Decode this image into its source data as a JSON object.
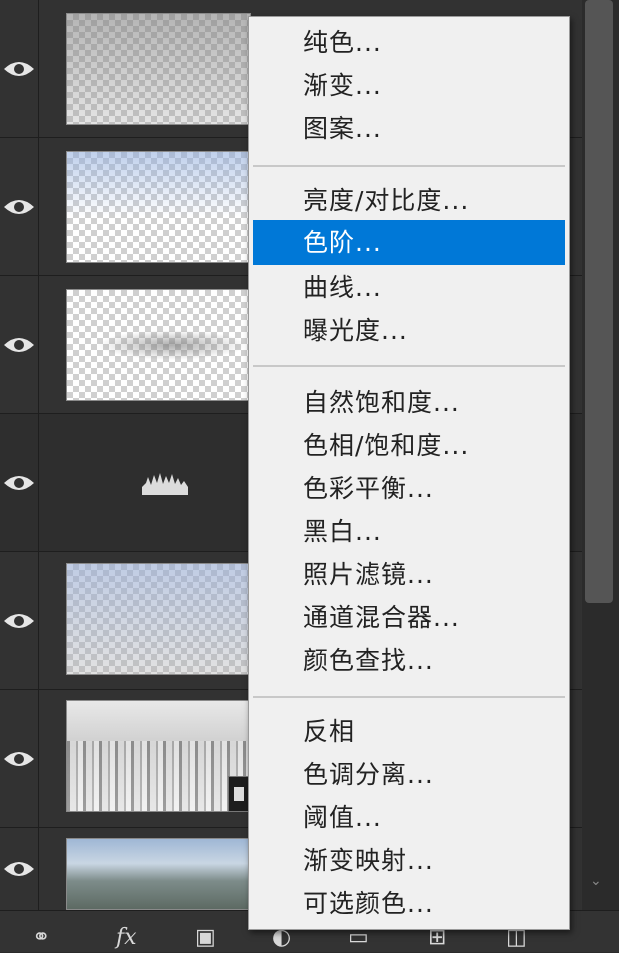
{
  "menu": {
    "groups": [
      [
        "纯色...",
        "渐变...",
        "图案..."
      ],
      [
        "亮度/对比度...",
        "色阶...",
        "曲线...",
        "曝光度..."
      ],
      [
        "自然饱和度...",
        "色相/饱和度...",
        "色彩平衡...",
        "黑白...",
        "照片滤镜...",
        "通道混合器...",
        "颜色查找..."
      ],
      [
        "反相",
        "色调分离...",
        "阈值...",
        "渐变映射...",
        "可选颜色..."
      ]
    ],
    "highlighted": "色阶..."
  },
  "layers": [
    {
      "visible": true,
      "thumbnail": "fog-layer-thumbnail"
    },
    {
      "visible": true,
      "thumbnail": "sky-gradient-thumbnail"
    },
    {
      "visible": true,
      "thumbnail": "mist-wisps-thumbnail"
    },
    {
      "visible": true,
      "thumbnail": "levels-adjustment-icon"
    },
    {
      "visible": true,
      "thumbnail": "sky-fog-thumbnail"
    },
    {
      "visible": true,
      "thumbnail": "city-bw-thumbnail"
    },
    {
      "visible": true,
      "thumbnail": "city-photo-thumbnail"
    }
  ],
  "toolbar": {
    "icons": [
      "link-layers-icon",
      "fx-icon",
      "add-mask-icon",
      "adjustment-layer-icon",
      "group-folder-icon",
      "new-layer-icon",
      "trash-icon"
    ],
    "fx_label": "fx"
  },
  "colors": {
    "panel": "#323232",
    "menu_bg": "#f0f0f0",
    "highlight": "#0078d7"
  }
}
